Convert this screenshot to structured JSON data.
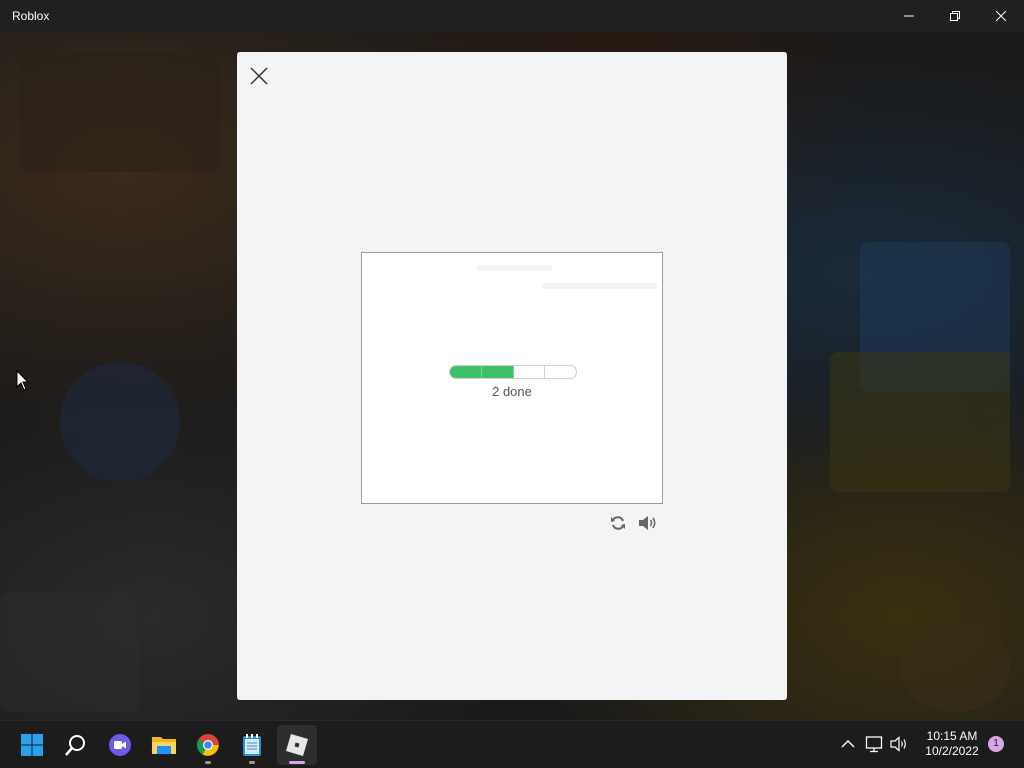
{
  "window": {
    "title": "Roblox",
    "controls": [
      "minimize-icon",
      "restore-icon",
      "close-icon"
    ]
  },
  "modal": {
    "close_icon": "close-icon",
    "background_color": "#f2f4f5",
    "progress": {
      "total_steps": 4,
      "completed_steps": 2,
      "text": "2 done",
      "color": "#3dbf6a"
    },
    "controls": {
      "reload_icon": "reload-icon",
      "audio_icon": "speaker-icon"
    }
  },
  "taskbar": {
    "items": [
      {
        "name": "start-icon"
      },
      {
        "name": "search-icon"
      },
      {
        "name": "video-chat-icon"
      },
      {
        "name": "file-explorer-icon"
      },
      {
        "name": "chrome-icon",
        "running": true
      },
      {
        "name": "notepad-icon",
        "running": true
      },
      {
        "name": "roblox-icon",
        "running": true,
        "active": true
      }
    ],
    "tray": {
      "icons": [
        "chevron-up-icon",
        "network-icon",
        "volume-icon"
      ],
      "time": "10:15 AM",
      "date": "10/2/2022",
      "notification_count": "1"
    }
  }
}
